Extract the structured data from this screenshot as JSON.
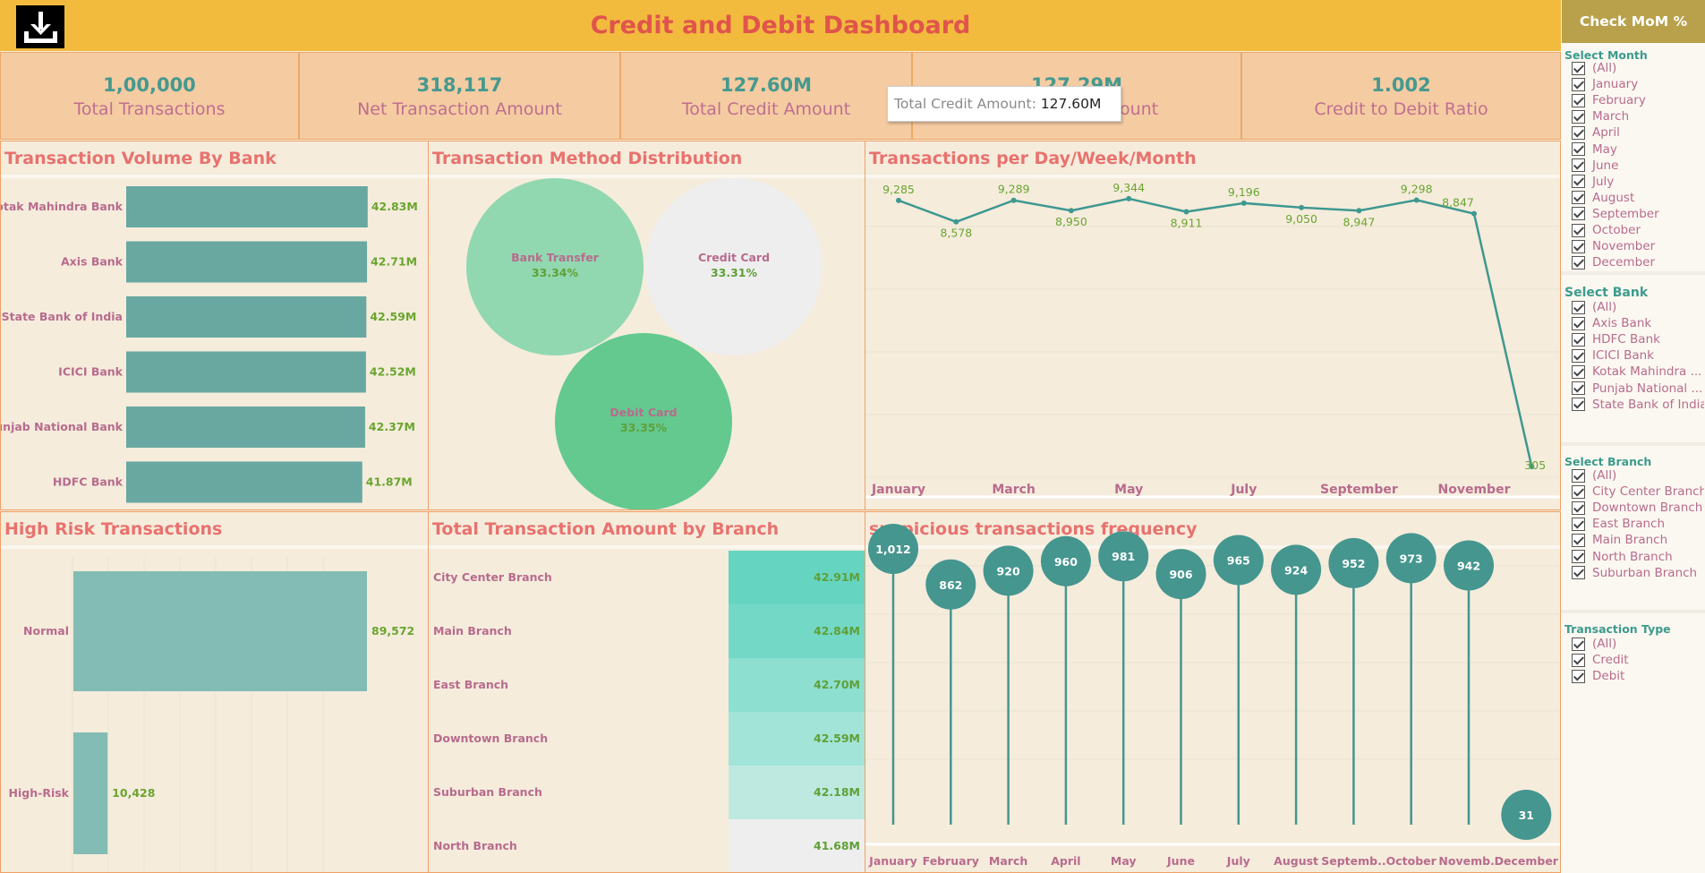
{
  "header": {
    "title": "Credit and Debit Dashboard",
    "download_icon": "download-icon",
    "mom_button_label": "Check MoM %"
  },
  "kpis": [
    {
      "value": "1,00,000",
      "label": "Total Transactions"
    },
    {
      "value": "318,117",
      "label": "Net Transaction Amount"
    },
    {
      "value": "127.60M",
      "label": "Total Credit Amount"
    },
    {
      "value": "127.29M",
      "label": "Total Debit Amount"
    },
    {
      "value": "1.002",
      "label": "Credit to Debit Ratio"
    }
  ],
  "tooltip": {
    "label": "Total Credit Amount:",
    "value": "127.60M"
  },
  "panels": {
    "bank_volume": "Transaction Volume By Bank",
    "method_distribution": "Transaction Method Distribution",
    "per_period": "Transactions per Day/Week/Month",
    "high_risk": "High Risk Transactions",
    "by_branch": "Total Transaction Amount by Branch",
    "suspicious": "suspicious transactions frequency"
  },
  "chart_data": [
    {
      "type": "bar",
      "orientation": "horizontal",
      "title": "Transaction Volume By Bank",
      "categories": [
        "Kotak Mahindra Bank",
        "Axis Bank",
        "State Bank of India",
        "ICICI Bank",
        "Punjab National Bank",
        "HDFC Bank"
      ],
      "values": [
        42.83,
        42.71,
        42.59,
        42.52,
        42.37,
        41.87
      ],
      "value_labels": [
        "42.83M",
        "42.71M",
        "42.59M",
        "42.52M",
        "42.37M",
        "41.87M"
      ],
      "unit": "M",
      "color": "#68a8a1"
    },
    {
      "type": "bubble",
      "title": "Transaction Method Distribution",
      "categories": [
        "Bank Transfer",
        "Credit Card",
        "Debit Card"
      ],
      "values": [
        33.34,
        33.31,
        33.35
      ],
      "value_labels": [
        "33.34%",
        "33.31%",
        "33.35%"
      ],
      "colors": [
        "#91d8b0",
        "#eeeeee",
        "#63c98f"
      ]
    },
    {
      "type": "line",
      "title": "Transactions per Day/Week/Month",
      "categories": [
        "January",
        "February",
        "March",
        "April",
        "May",
        "June",
        "July",
        "August",
        "September",
        "October",
        "November",
        "December"
      ],
      "values": [
        9285,
        8578,
        9289,
        8950,
        9344,
        8911,
        9196,
        9050,
        8947,
        9298,
        8847,
        305
      ],
      "value_labels": [
        "9,285",
        "8,578",
        "9,289",
        "8,950",
        "9,344",
        "8,911",
        "9,196",
        "9,050",
        "8,947",
        "9,298",
        "8,847",
        "305"
      ],
      "tick_labels": [
        "January",
        "March",
        "May",
        "July",
        "September",
        "November"
      ],
      "color": "#3d9890"
    },
    {
      "type": "bar",
      "orientation": "vertical",
      "title": "High Risk Transactions",
      "categories": [
        "Normal",
        "High-Risk"
      ],
      "values": [
        89572,
        10428
      ],
      "value_labels": [
        "89,572",
        "10,428"
      ],
      "color": "#83bcb4"
    },
    {
      "type": "table",
      "title": "Total Transaction Amount by Branch",
      "categories": [
        "City Center Branch",
        "Main Branch",
        "East Branch",
        "Downtown Branch",
        "Suburban Branch",
        "North Branch"
      ],
      "values": [
        42.91,
        42.84,
        42.7,
        42.59,
        42.18,
        41.68
      ],
      "value_labels": [
        "42.91M",
        "42.84M",
        "42.70M",
        "42.59M",
        "42.18M",
        "41.68M"
      ],
      "colors": [
        "#65d5c2",
        "#73d8c6",
        "#8ddfd0",
        "#a3e4d8",
        "#bde9e1",
        "#eeeeee"
      ]
    },
    {
      "type": "lollipop",
      "title": "suspicious transactions frequency",
      "categories": [
        "January",
        "February",
        "March",
        "April",
        "May",
        "June",
        "July",
        "August",
        "Septemb..",
        "October",
        "Novemb..",
        "December"
      ],
      "values": [
        1012,
        862,
        920,
        960,
        981,
        906,
        965,
        924,
        952,
        973,
        942,
        31
      ],
      "value_labels": [
        "1,012",
        "862",
        "920",
        "960",
        "981",
        "906",
        "965",
        "924",
        "952",
        "973",
        "942",
        "31"
      ],
      "color": "#45968f"
    }
  ],
  "filters": [
    {
      "title": "Select Month",
      "items": [
        "(All)",
        "January",
        "February",
        "March",
        "April",
        "May",
        "June",
        "July",
        "August",
        "September",
        "October",
        "November",
        "December"
      ]
    },
    {
      "title": "Select Bank",
      "items": [
        "(All)",
        "Axis Bank",
        "HDFC Bank",
        "ICICI Bank",
        "Kotak Mahindra ...",
        "Punjab National ...",
        "State Bank of India"
      ]
    },
    {
      "title": "Select Branch",
      "items": [
        "(All)",
        "City Center Branch",
        "Downtown Branch",
        "East Branch",
        "Main Branch",
        "North Branch",
        "Suburban Branch"
      ]
    },
    {
      "title": "Transaction Type",
      "items": [
        "(All)",
        "Credit",
        "Debit"
      ]
    }
  ]
}
